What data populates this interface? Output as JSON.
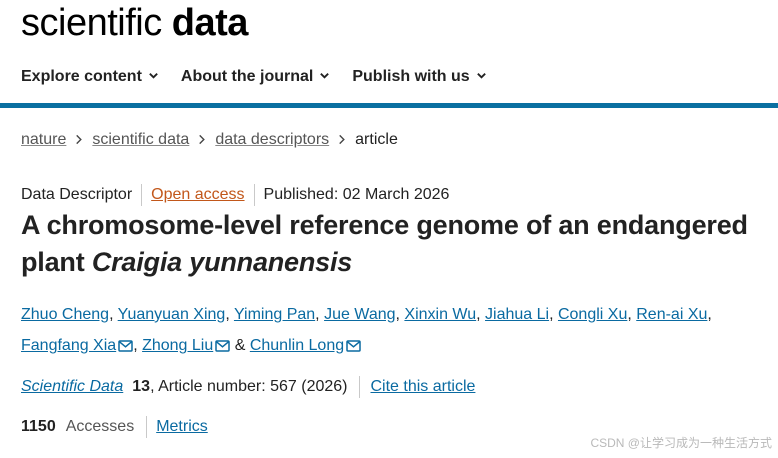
{
  "brand": {
    "word1": "scientific",
    "word2": "data"
  },
  "nav": [
    {
      "label": "Explore content"
    },
    {
      "label": "About the journal"
    },
    {
      "label": "Publish with us"
    }
  ],
  "breadcrumb": {
    "items": [
      "nature",
      "scientific data",
      "data descriptors"
    ],
    "current": "article"
  },
  "article": {
    "type": "Data Descriptor",
    "access": "Open access",
    "published": "Published: 02 March 2026",
    "title_main": "A chromosome-level reference genome of an endangered plant",
    "title_species": "Craigia yunnanensis",
    "authors": [
      "Zhuo Cheng",
      "Yuanyuan Xing",
      "Yiming Pan",
      "Jue Wang",
      "Xinxin Wu",
      "Jiahua Li",
      "Congli Xu",
      "Ren-ai Xu",
      "Fangfang Xia",
      "Zhong Liu",
      "Chunlin Long"
    ],
    "authors_and": "&",
    "journal": "Scientific Data",
    "volume": "13",
    "article_number": ", Article number: 567 (2026)",
    "cite": "Cite this article",
    "accesses_count": "1150",
    "accesses_label": "Accesses",
    "metrics": "Metrics"
  },
  "watermark": "CSDN @让学习成为一种生活方式",
  "colors": {
    "link": "#0a6aa1",
    "open_access": "#c2571a",
    "nav_border": "#0a70a1"
  },
  "icons": [
    "chevron-down-icon",
    "chevron-right-icon",
    "mail-icon"
  ]
}
